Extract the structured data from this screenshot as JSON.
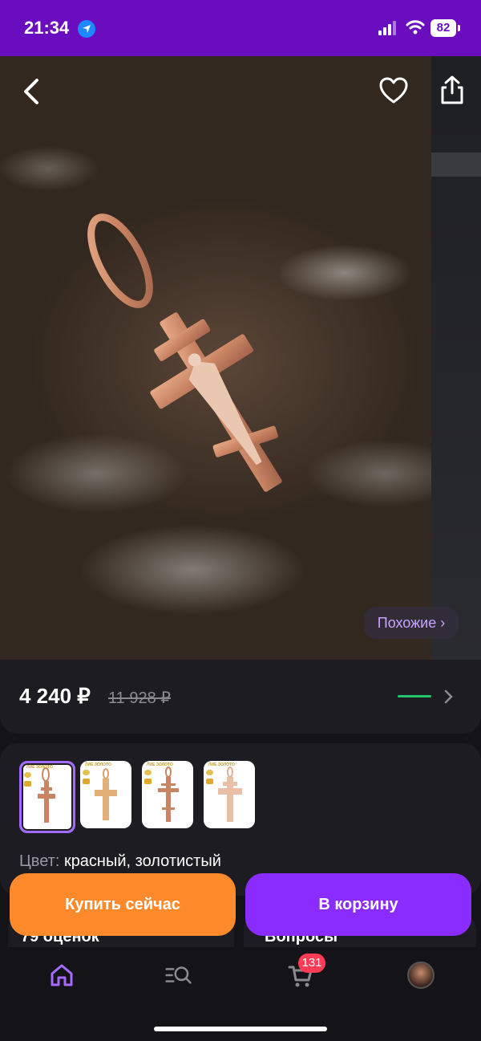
{
  "status_bar": {
    "time": "21:34",
    "battery": "82"
  },
  "photo": {
    "similar_label": "Похожие ›"
  },
  "price": {
    "current": "4 240 ₽",
    "old": "11 928 ₽"
  },
  "variants": {
    "thumbnails": [
      {
        "tag": "ЛИЕ ЗОЛОТО",
        "selected": true
      },
      {
        "tag": "ЛИЕ ЗОЛОТО",
        "selected": false
      },
      {
        "tag": "ЛИЕ ЗОЛОТО",
        "selected": false
      },
      {
        "tag": "ЛИЕ ЗОЛОТО",
        "selected": false
      }
    ],
    "color_label": "Цвет:",
    "color_value": "красный, золотистый"
  },
  "under_buttons": {
    "reviews": "79 оценок",
    "questions": "Вопросы"
  },
  "buttons": {
    "buy_now": "Купить сейчас",
    "add_to_cart": "В корзину"
  },
  "tabbar": {
    "cart_badge": "131"
  },
  "colors": {
    "status_bar": "#6a0dbf",
    "buy_button": "#ff8a2b",
    "cart_button": "#8a2cff",
    "accent_green": "#22c56a",
    "badge": "#ff3b55"
  }
}
